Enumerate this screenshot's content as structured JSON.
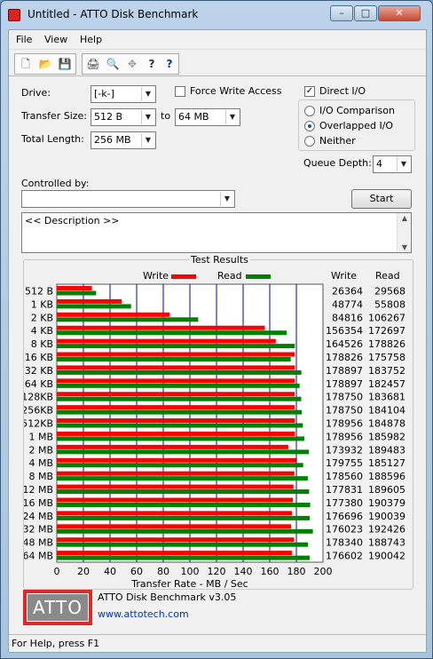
{
  "window": {
    "title": "Untitled - ATTO Disk Benchmark",
    "min_glyph": "–",
    "max_glyph": "□",
    "close_glyph": "✕"
  },
  "menu": [
    "File",
    "View",
    "Help"
  ],
  "toolbar": {
    "icons": [
      "new-file-icon",
      "open-folder-icon",
      "save-icon",
      "print-icon",
      "print-preview-icon",
      "move-icon",
      "help-icon",
      "context-help-icon"
    ],
    "glyphs": [
      "🗋",
      "📂",
      "💾",
      "🖨",
      "🔍",
      "✥",
      "?",
      "?"
    ]
  },
  "settings": {
    "drive_label": "Drive:",
    "drive_value": "[-k-]",
    "force_write_label": "Force Write Access",
    "force_write_checked": false,
    "direct_io_label": "Direct I/O",
    "direct_io_checked": true,
    "transfer_size_label": "Transfer Size:",
    "transfer_from": "512 B",
    "to_label": "to",
    "transfer_to": "64 MB",
    "total_length_label": "Total Length:",
    "total_length": "256 MB",
    "io_comparison_label": "I/O Comparison",
    "overlapped_io_label": "Overlapped I/O",
    "neither_label": "Neither",
    "io_mode_selected": "Overlapped I/O",
    "queue_depth_label": "Queue Depth:",
    "queue_depth": "4",
    "controlled_by_label": "Controlled by:",
    "controlled_by_value": "",
    "start_label": "Start",
    "description": "<< Description >>"
  },
  "results": {
    "group_title": "Test Results",
    "legend_write": "Write",
    "legend_read": "Read",
    "col_write": "Write",
    "col_read": "Read",
    "xlabel": "Transfer Rate - MB / Sec"
  },
  "chart_data": {
    "type": "bar",
    "orientation": "horizontal",
    "title": "Test Results",
    "xlabel": "Transfer Rate - MB / Sec",
    "xlim": [
      0,
      200
    ],
    "xticks": [
      0,
      20,
      40,
      60,
      80,
      100,
      120,
      140,
      160,
      180,
      200
    ],
    "grid": true,
    "legend": "top",
    "categories": [
      "512 B",
      "1 KB",
      "2 KB",
      "4 KB",
      "8 KB",
      "16 KB",
      "32 KB",
      "64 KB",
      "128KB",
      "256KB",
      "512KB",
      "1 MB",
      "2 MB",
      "4 MB",
      "8 MB",
      "12 MB",
      "16 MB",
      "24 MB",
      "32 MB",
      "48 MB",
      "64 MB"
    ],
    "series": [
      {
        "name": "Write",
        "color": "#ff0000",
        "values": [
          26364,
          48774,
          84816,
          156354,
          164526,
          178826,
          178897,
          178897,
          178750,
          178750,
          178956,
          178956,
          173932,
          179755,
          178560,
          177831,
          177380,
          176696,
          176023,
          178340,
          176602
        ]
      },
      {
        "name": "Read",
        "color": "#008000",
        "values": [
          29568,
          55808,
          106267,
          172697,
          178826,
          175758,
          183752,
          182457,
          183681,
          184104,
          184878,
          185982,
          189483,
          185127,
          188596,
          189605,
          190379,
          190039,
          192426,
          188743,
          190042
        ]
      }
    ],
    "value_unit_note": "values are KB/s as printed; axis in MB/s"
  },
  "footer": {
    "logo_text": "ATTO",
    "product": "ATTO Disk Benchmark v3.05",
    "url": "www.attotech.com"
  },
  "status": "For Help, press F1",
  "colors": {
    "write": "#ff0000",
    "read": "#008000",
    "grid": "#0000c0",
    "logo": "#d92b2b"
  }
}
